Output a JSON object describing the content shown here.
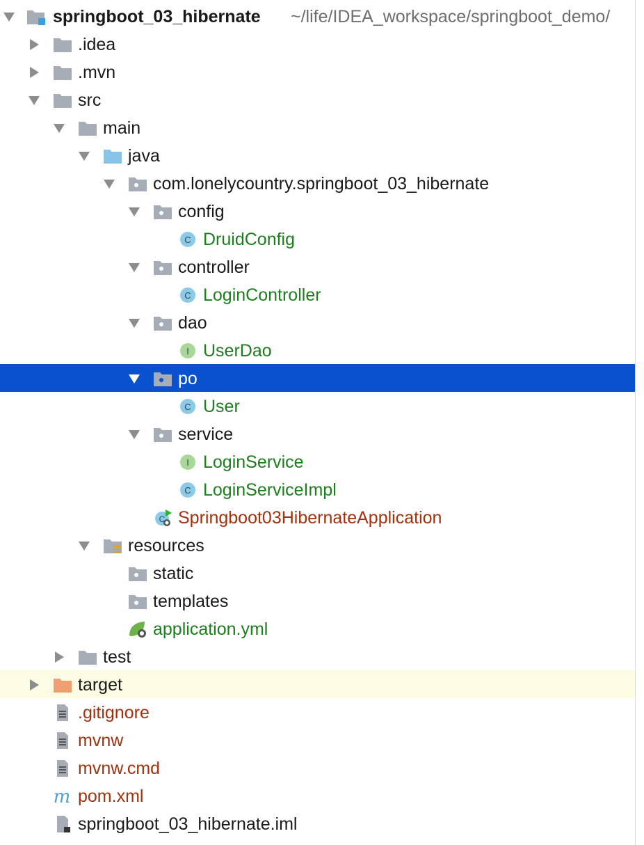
{
  "project": {
    "name": "springboot_03_hibernate",
    "path": "~/life/IDEA_workspace/springboot_demo/"
  },
  "nodes": [
    {
      "label": "springboot_03_hibernate",
      "arrow": "down",
      "icon": "module-folder-icon"
    },
    {
      "label": ".idea",
      "arrow": "right",
      "icon": "folder-icon"
    },
    {
      "label": ".mvn",
      "arrow": "right",
      "icon": "folder-icon"
    },
    {
      "label": "src",
      "arrow": "down",
      "icon": "folder-icon"
    },
    {
      "label": "main",
      "arrow": "down",
      "icon": "folder-icon"
    },
    {
      "label": "java",
      "arrow": "down",
      "icon": "source-folder-icon"
    },
    {
      "label": "com.lonelycountry.springboot_03_hibernate",
      "arrow": "down",
      "icon": "package-icon"
    },
    {
      "label": "config",
      "arrow": "down",
      "icon": "package-icon"
    },
    {
      "label": "DruidConfig",
      "arrow": "none",
      "icon": "class-icon"
    },
    {
      "label": "controller",
      "arrow": "down",
      "icon": "package-icon"
    },
    {
      "label": "LoginController",
      "arrow": "none",
      "icon": "class-icon"
    },
    {
      "label": "dao",
      "arrow": "down",
      "icon": "package-icon"
    },
    {
      "label": "UserDao",
      "arrow": "none",
      "icon": "interface-icon"
    },
    {
      "label": "po",
      "arrow": "down",
      "icon": "package-icon",
      "selected": true
    },
    {
      "label": "User",
      "arrow": "none",
      "icon": "class-icon"
    },
    {
      "label": "service",
      "arrow": "down",
      "icon": "package-icon"
    },
    {
      "label": "LoginService",
      "arrow": "none",
      "icon": "interface-icon"
    },
    {
      "label": "LoginServiceImpl",
      "arrow": "none",
      "icon": "class-icon"
    },
    {
      "label": "Springboot03HibernateApplication",
      "arrow": "none",
      "icon": "spring-boot-run-icon"
    },
    {
      "label": "resources",
      "arrow": "down",
      "icon": "resources-folder-icon"
    },
    {
      "label": "static",
      "arrow": "none",
      "icon": "package-icon"
    },
    {
      "label": "templates",
      "arrow": "none",
      "icon": "package-icon"
    },
    {
      "label": "application.yml",
      "arrow": "none",
      "icon": "spring-config-icon"
    },
    {
      "label": "test",
      "arrow": "right",
      "icon": "folder-icon"
    },
    {
      "label": "target",
      "arrow": "right",
      "icon": "excluded-folder-icon",
      "highlight": true
    },
    {
      "label": ".gitignore",
      "arrow": "none",
      "icon": "text-file-icon"
    },
    {
      "label": "mvnw",
      "arrow": "none",
      "icon": "text-file-icon"
    },
    {
      "label": "mvnw.cmd",
      "arrow": "none",
      "icon": "text-file-icon"
    },
    {
      "label": "pom.xml",
      "arrow": "none",
      "icon": "maven-icon"
    },
    {
      "label": "springboot_03_hibernate.iml",
      "arrow": "none",
      "icon": "iml-file-icon"
    }
  ],
  "colors": {
    "selection": "#0a51d0",
    "highlight": "#fcfbe4",
    "class_name": "#1e7d1e",
    "untracked": "#a0320f",
    "folder": "#a6adb6",
    "source_folder": "#87c4e8",
    "excluded_folder": "#f0a070"
  }
}
